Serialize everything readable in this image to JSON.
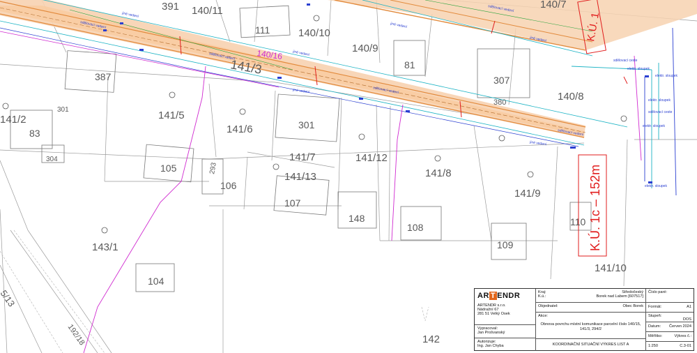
{
  "parcels": {
    "p391": "391",
    "p140_11": "140/11",
    "p140_7": "140/7",
    "p111": "111",
    "p140_10": "140/10",
    "p140_9": "140/9",
    "p81": "81",
    "p387": "387",
    "p140_16": "140/16",
    "p141_3": "141/3",
    "p307": "307",
    "p140_8": "140/8",
    "p380": "380",
    "p141_5": "141/5",
    "p301a": "301",
    "p141_2": "141/2",
    "p83": "83",
    "p141_6": "141/6",
    "p301": "301",
    "p304": "304",
    "p141_7": "141/7",
    "p141_12": "141/12",
    "p141_8": "141/8",
    "p105": "105",
    "p293": "293",
    "p106": "106",
    "p141_13": "141/13",
    "p141_9": "141/9",
    "p107": "107",
    "p148": "148",
    "p108": "108",
    "p110": "110",
    "p143_1": "143/1",
    "p109": "109",
    "p104": "104",
    "p141_10": "141/10",
    "p142": "142",
    "p5_13": "5/13",
    "p192_18": "192/18"
  },
  "road_labels": {
    "ku_top": "K.Ú. 1",
    "ku_right": "K.Ú. 1c – 152m"
  },
  "annotations": {
    "a1": "sdělovací vedení",
    "a2": "sdělovací vedení",
    "a3": "sdělovací vedení",
    "a4": "sdělovací vedení",
    "a5": "sdělovací vedení",
    "a6": "jiné vedení",
    "a7": "jiné vedení",
    "a8": "jiné vedení",
    "a9": "jiné vedení",
    "a10": "jiné vedení",
    "a11": "jiné vedení",
    "a12": "sdělovací ceste",
    "a13": "sdělovací ceste",
    "a14": "elektr. sloupek",
    "a15": "elektr. sloupek",
    "a16": "elektr. sloupek",
    "a17": "elektr. sloupek",
    "a18": "elektr. sloupek"
  },
  "title_block": {
    "company": {
      "logo_left": "AR",
      "logo_mid": "T",
      "logo_right": "ENDR",
      "name": "ARTENDR s.r.o.",
      "street": "Nádražní 67",
      "city": "281 51 Velký Osek"
    },
    "prepared_label": "Vypracoval:",
    "prepared_name": "Jan Prošvanský",
    "author_label": "Autorizuje:",
    "author_name": "Ing. Jan Chyba",
    "kraj_label": "Kraj:",
    "kraj_value": "Středočeský",
    "ku_label": "K.ú.:",
    "ku_value": "Borek nad Labem [607517]",
    "client_label": "Objednatel:",
    "client_value": "Obec Borek",
    "action_label": "Akce:",
    "action_value": "Obnova povrchu místní komunikace parcelní číslo 140/15, 141/3, 294/2",
    "drawing_title": "KOORDINAČNÍ SITUAČNÍ VÝKRES LIST A",
    "paré_label": "Číslo paré:",
    "format_label": "Formát:",
    "format_value": "A1",
    "stage_label": "Stupeň:",
    "stage_value": "DOS",
    "date_label": "Datum:",
    "date_value": "Červen 2024",
    "scale_label": "Měřítko:",
    "scale_value": "1:250",
    "drawing_no_label": "Výkres č.:",
    "drawing_no_value": "C.3-01"
  },
  "colors": {
    "road_fill": "#f7d2b0",
    "road_band": "#f9c99b",
    "parcel_line": "#9a9a9a",
    "utility_blue": "#2a3fd1",
    "utility_cyan": "#1bb3c4",
    "utility_magenta": "#d02ad0",
    "utility_red": "#e11d1d",
    "utility_green": "#27a43b",
    "logo_orange": "#e2661b"
  }
}
